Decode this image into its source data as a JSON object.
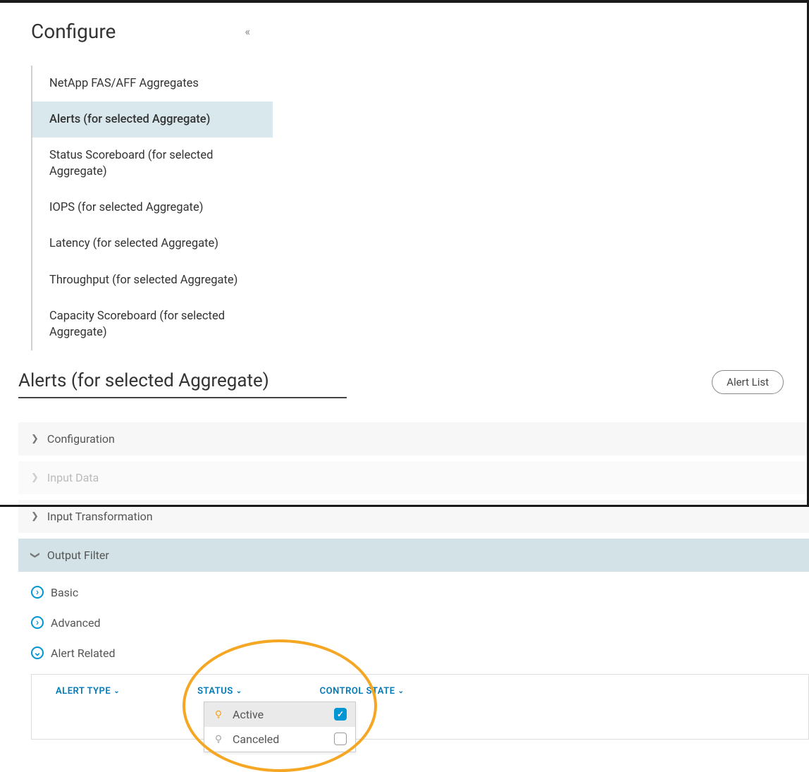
{
  "sidebar": {
    "title": "Configure",
    "items": [
      {
        "label": "NetApp FAS/AFF Aggregates",
        "selected": false
      },
      {
        "label": "Alerts (for selected Aggregate)",
        "selected": true
      },
      {
        "label": "Status Scoreboard (for selected Aggregate)",
        "selected": false
      },
      {
        "label": "IOPS (for selected Aggregate)",
        "selected": false
      },
      {
        "label": "Latency (for selected Aggregate)",
        "selected": false
      },
      {
        "label": "Throughput (for selected Aggregate)",
        "selected": false
      },
      {
        "label": "Capacity Scoreboard (for selected Aggregate)",
        "selected": false
      }
    ]
  },
  "main": {
    "title": "Alerts (for selected Aggregate)",
    "alert_list_btn": "Alert List",
    "sections": {
      "configuration": "Configuration",
      "input_data": "Input Data",
      "input_transformation": "Input Transformation",
      "output_filter": "Output Filter"
    },
    "sub_options": {
      "basic": "Basic",
      "advanced": "Advanced",
      "alert_related": "Alert Related"
    },
    "columns": {
      "alert_type": "ALERT TYPE",
      "status": "STATUS",
      "control_state": "CONTROL STATE"
    },
    "status_options": [
      {
        "label": "Active",
        "checked": true
      },
      {
        "label": "Canceled",
        "checked": false
      }
    ]
  }
}
